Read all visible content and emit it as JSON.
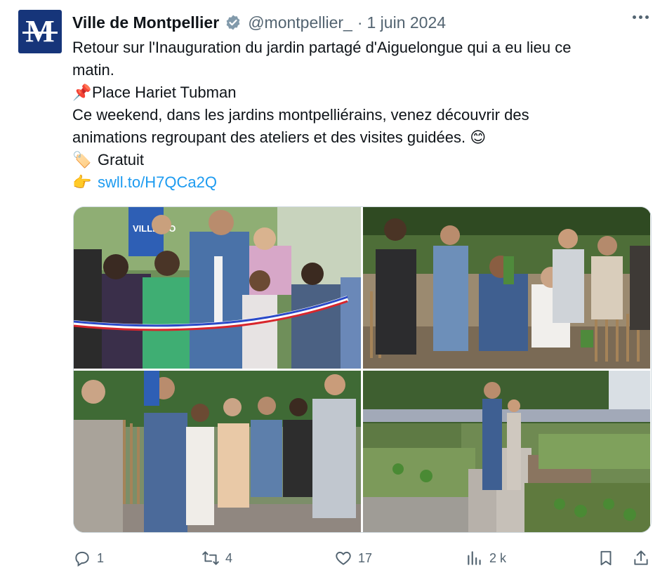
{
  "tweet": {
    "author_name": "Ville de Montpellier",
    "handle": "@montpellier_",
    "separator": "·",
    "date": "1 juin 2024",
    "avatar_letter": "M",
    "lines": [
      "Retour sur l'Inauguration du jardin partagé d'Aiguelongue qui a eu lieu ce",
      "matin.",
      "Place Hariet Tubman",
      "Ce weekend, dans les jardins montpelliérains, venez découvrir des",
      "animations regroupant des ateliers et des visites guidées.",
      "Gratuit",
      "swll.to/H7QCa2Q"
    ],
    "emoji": {
      "pin": "📌",
      "smile": "😊",
      "tag": "🏷️",
      "point": "👉"
    },
    "link_color": "#1d9bf0"
  },
  "media": {
    "photos": [
      {
        "icon": "ribbon-cutting-photo"
      },
      {
        "icon": "group-garden-photo"
      },
      {
        "icon": "speech-garden-photo"
      },
      {
        "icon": "garden-beds-photo"
      }
    ],
    "photo_text": "VILLE MO"
  },
  "actions": {
    "replies": "1",
    "reposts": "4",
    "likes": "17",
    "views": "2 k"
  },
  "colors": {
    "brand": "#16357a",
    "verified": "#829aab",
    "muted": "#536471"
  }
}
